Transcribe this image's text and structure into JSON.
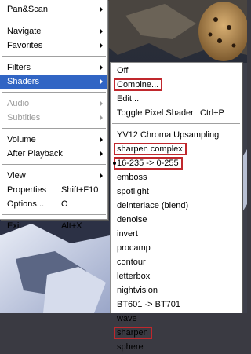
{
  "main_menu": {
    "items": [
      {
        "label": "Pan&Scan",
        "submenu": true
      },
      {
        "label": "Navigate",
        "submenu": true
      },
      {
        "label": "Favorites",
        "submenu": true
      },
      {
        "label": "Filters",
        "submenu": true
      },
      {
        "label": "Shaders",
        "submenu": true,
        "active": true
      },
      {
        "label": "Audio",
        "submenu": true,
        "disabled": true
      },
      {
        "label": "Subtitles",
        "submenu": true,
        "disabled": true
      },
      {
        "label": "Volume",
        "submenu": true
      },
      {
        "label": "After Playback",
        "submenu": true
      },
      {
        "label": "View",
        "submenu": true
      },
      {
        "label": "Properties",
        "shortcut": "Shift+F10"
      },
      {
        "label": "Options...",
        "shortcut": "O"
      },
      {
        "label": "Exit",
        "shortcut": "Alt+X"
      }
    ]
  },
  "shaders_menu": {
    "items": [
      {
        "label": "Off"
      },
      {
        "label": "Combine...",
        "highlighted": true
      },
      {
        "label": "Edit..."
      },
      {
        "label": "Toggle Pixel Shader",
        "shortcut": "Ctrl+P"
      },
      {
        "label": "YV12 Chroma Upsampling"
      },
      {
        "label": "sharpen complex",
        "highlighted": true
      },
      {
        "label": "16-235 -> 0-255",
        "highlighted": true,
        "checked": true
      },
      {
        "label": "emboss"
      },
      {
        "label": "spotlight"
      },
      {
        "label": "deinterlace (blend)"
      },
      {
        "label": "denoise"
      },
      {
        "label": "invert"
      },
      {
        "label": "procamp"
      },
      {
        "label": "contour"
      },
      {
        "label": "letterbox"
      },
      {
        "label": "nightvision"
      },
      {
        "label": "BT601 -> BT701"
      },
      {
        "label": "wave"
      },
      {
        "label": "sharpen",
        "highlighted": true
      },
      {
        "label": "sphere"
      }
    ]
  },
  "colors": {
    "selection": "#3165c4",
    "highlight_box": "#c0282d",
    "disabled_text": "#9c9c9c"
  }
}
